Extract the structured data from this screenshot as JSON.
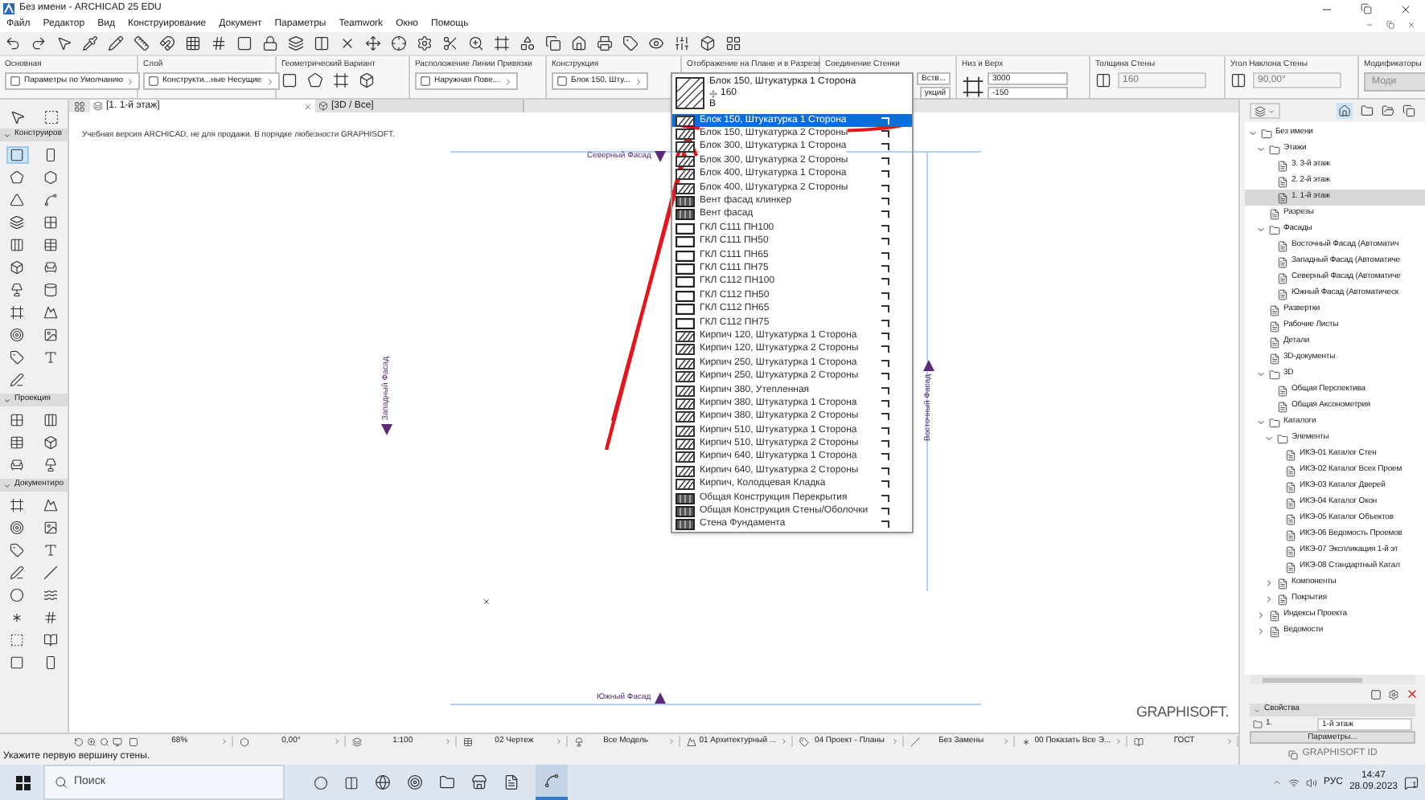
{
  "window": {
    "title": "Без имени - ARCHICAD 25 EDU"
  },
  "menu": [
    "Файл",
    "Редактор",
    "Вид",
    "Конструирование",
    "Документ",
    "Параметры",
    "Teamwork",
    "Окно",
    "Помощь"
  ],
  "info_box": {
    "groups": [
      {
        "label": "Основная",
        "kind": "dropdown",
        "value": "Параметры по Умолчанию"
      },
      {
        "label": "Слой",
        "kind": "dropdown",
        "value": "Конструкти...ные Несущие"
      },
      {
        "label": "Геометрический Вариант",
        "kind": "icons"
      },
      {
        "label": "Расположение Линии Привязки",
        "kind": "dropdown",
        "value": "Наружная Пове..."
      },
      {
        "label": "Конструкция",
        "kind": "dropdown",
        "value": "Блок 150, Шту..."
      },
      {
        "label": "Отображение на Плане и в Разрезе",
        "kind": "blank"
      },
      {
        "label": "Соединение Стенки",
        "kind": "pair",
        "values": [
          "Вств...",
          "укций"
        ]
      },
      {
        "label": "Низ и Верх",
        "kind": "fields",
        "values": [
          "3000",
          "-150"
        ]
      },
      {
        "label": "Толщина Стены",
        "kind": "field",
        "value": "160",
        "disabled": true
      },
      {
        "label": "Угол Наклона Стены",
        "kind": "field",
        "value": "90,00°",
        "disabled": true
      },
      {
        "label": "Модификаторы",
        "kind": "button",
        "value": "Моди"
      }
    ]
  },
  "toolbox": {
    "sections": [
      {
        "label": "Конструиров",
        "expanded": true,
        "tools": [
          {
            "selected": true
          },
          {
            "selected": false
          },
          {
            "selected": false
          },
          {
            "selected": false
          },
          {
            "selected": false
          },
          {
            "selected": false
          },
          {
            "selected": false
          },
          {
            "selected": false
          },
          {
            "selected": false
          },
          {
            "selected": false
          },
          {
            "selected": false
          },
          {
            "selected": false
          },
          {
            "selected": false
          },
          {
            "selected": false
          },
          {
            "selected": false
          },
          {
            "selected": false
          },
          {
            "selected": false
          },
          {
            "selected": false
          },
          {
            "selected": false
          },
          {
            "selected": false
          },
          {
            "selected": false
          }
        ]
      },
      {
        "label": "Проекция",
        "expanded": true,
        "tools": [
          {
            "selected": false
          },
          {
            "selected": false
          },
          {
            "selected": false
          },
          {
            "selected": false
          },
          {
            "selected": false
          },
          {
            "selected": false
          }
        ]
      },
      {
        "label": "Документиро",
        "expanded": true,
        "tools": [
          {
            "selected": false
          },
          {
            "selected": false
          },
          {
            "selected": false
          },
          {
            "selected": false
          },
          {
            "selected": false
          },
          {
            "selected": false
          },
          {
            "selected": false
          },
          {
            "selected": false
          },
          {
            "selected": false
          },
          {
            "selected": false
          },
          {
            "selected": false
          },
          {
            "selected": false
          },
          {
            "selected": false
          },
          {
            "selected": false
          },
          {
            "selected": false
          },
          {
            "selected": false
          }
        ]
      }
    ]
  },
  "tabs": [
    {
      "label": "[1. 1-й этаж]",
      "selected": true
    },
    {
      "label": "[3D / Все]",
      "selected": false
    }
  ],
  "canvas": {
    "notice": "Учебная версия ARCHICAD, не для продажи. В порядке любезности GRAPHISOFT.",
    "markers": [
      {
        "label": "Северный Фасад",
        "kind": "top"
      },
      {
        "label": "Западный Фасад",
        "kind": "left"
      },
      {
        "label": "Восточный Фасад",
        "kind": "right"
      },
      {
        "label": "Южный Фасад",
        "kind": "bottom"
      }
    ],
    "logo": "GRAPHISOFT."
  },
  "dropdown": {
    "preview": {
      "name": "Блок 150, Штукатурка 1 Сторона",
      "thickness": "160",
      "code": "В"
    },
    "items": [
      {
        "label": "Блок 150, Штукатурка 1 Сторона",
        "kind": "hatch",
        "selected": true
      },
      {
        "label": "Блок 150, Штукатурка 2 Стороны",
        "kind": "hatch",
        "selected": false
      },
      {
        "label": "Блок 300, Штукатурка 1 Сторона",
        "kind": "hatch",
        "selected": false
      },
      {
        "label": "Блок 300, Штукатурка 2 Стороны",
        "kind": "hatch",
        "selected": false
      },
      {
        "label": "Блок 400, Штукатурка 1 Сторона",
        "kind": "hatch",
        "selected": false
      },
      {
        "label": "Блок 400, Штукатурка 2 Стороны",
        "kind": "hatch",
        "selected": false
      },
      {
        "label": "Вент фасад клинкер",
        "kind": "dark",
        "selected": false
      },
      {
        "label": "Вент фасад",
        "kind": "dark",
        "selected": false
      },
      {
        "label": "ГКЛ С111 ПН100",
        "kind": "frame",
        "selected": false
      },
      {
        "label": "ГКЛ С111 ПН50",
        "kind": "frame",
        "selected": false
      },
      {
        "label": "ГКЛ С111 ПН65",
        "kind": "frame",
        "selected": false
      },
      {
        "label": "ГКЛ С111 ПН75",
        "kind": "frame",
        "selected": false
      },
      {
        "label": "ГКЛ С112 ПН100",
        "kind": "frame",
        "selected": false
      },
      {
        "label": "ГКЛ С112 ПН50",
        "kind": "frame",
        "selected": false
      },
      {
        "label": "ГКЛ С112 ПН65",
        "kind": "frame",
        "selected": false
      },
      {
        "label": "ГКЛ С112 ПН75",
        "kind": "frame",
        "selected": false
      },
      {
        "label": "Кирпич 120, Штукатурка 1 Сторона",
        "kind": "hatch",
        "selected": false
      },
      {
        "label": "Кирпич 120, Штукатурка 2 Стороны",
        "kind": "hatch",
        "selected": false
      },
      {
        "label": "Кирпич 250, Штукатурка 1 Сторона",
        "kind": "hatch",
        "selected": false
      },
      {
        "label": "Кирпич 250, Штукатурка 2 Стороны",
        "kind": "hatch",
        "selected": false
      },
      {
        "label": "Кирпич 380, Утепленная",
        "kind": "hatch",
        "selected": false
      },
      {
        "label": "Кирпич 380, Штукатурка 1 Сторона",
        "kind": "hatch",
        "selected": false
      },
      {
        "label": "Кирпич 380, Штукатурка 2 Стороны",
        "kind": "hatch",
        "selected": false
      },
      {
        "label": "Кирпич 510, Штукатурка 1 Сторона",
        "kind": "hatch",
        "selected": false
      },
      {
        "label": "Кирпич 510, Штукатурка 2 Стороны",
        "kind": "hatch",
        "selected": false
      },
      {
        "label": "Кирпич 640, Штукатурка 1 Сторона",
        "kind": "hatch",
        "selected": false
      },
      {
        "label": "Кирпич 640, Штукатурка 2 Стороны",
        "kind": "hatch",
        "selected": false
      },
      {
        "label": "Кирпич, Колодцевая Кладка",
        "kind": "hatch",
        "selected": false
      },
      {
        "label": "Общая Конструкция Перекрытия",
        "kind": "dark",
        "selected": false
      },
      {
        "label": "Общая Конструкция Стены/Оболочки",
        "kind": "dark",
        "selected": false
      },
      {
        "label": "Стена Фундамента",
        "kind": "dark",
        "selected": false
      }
    ]
  },
  "navigator": {
    "tree": [
      {
        "label": "Без имени",
        "expanded": true,
        "children": [
          {
            "label": "Этажи",
            "expanded": true,
            "children": [
              {
                "label": "3. 3-й этаж",
                "selected": false
              },
              {
                "label": "2. 2-й этаж",
                "selected": false
              },
              {
                "label": "1. 1-й этаж",
                "selected": true
              }
            ]
          },
          {
            "label": "Разрезы"
          },
          {
            "label": "Фасады",
            "expanded": true,
            "children": [
              {
                "label": "Восточный Фасад (Автоматич"
              },
              {
                "label": "Западный Фасад (Автоматиче"
              },
              {
                "label": "Северный Фасад (Автоматиче"
              },
              {
                "label": "Южный Фасад (Автоматическ"
              }
            ]
          },
          {
            "label": "Развертки"
          },
          {
            "label": "Рабочие Листы"
          },
          {
            "label": "Детали"
          },
          {
            "label": "3D-документы"
          },
          {
            "label": "3D",
            "expanded": true,
            "children": [
              {
                "label": "Общая Перспектива"
              },
              {
                "label": "Общая Аксонометрия"
              }
            ]
          },
          {
            "label": "Каталоги",
            "expanded": true,
            "children": [
              {
                "label": "Элементы",
                "expanded": true,
                "children": [
                  {
                    "label": "ИКЭ-01 Каталог Стен"
                  },
                  {
                    "label": "ИКЭ-02 Каталог Всех Проем"
                  },
                  {
                    "label": "ИКЭ-03 Каталог Дверей"
                  },
                  {
                    "label": "ИКЭ-04 Каталог Окон"
                  },
                  {
                    "label": "ИКЭ-05 Каталог Объектов"
                  },
                  {
                    "label": "ИКЭ-06 Ведомость Проемов"
                  },
                  {
                    "label": "ИКЭ-07 Экспликация 1-й эт"
                  },
                  {
                    "label": "ИКЭ-08 Стандартный Катал"
                  }
                ]
              },
              {
                "label": "Компоненты",
                "expanded": false
              },
              {
                "label": "Покрытия",
                "expanded": false
              }
            ]
          },
          {
            "label": "Индексы Проекта",
            "expanded": false
          },
          {
            "label": "Ведомости",
            "expanded": false
          }
        ]
      }
    ],
    "properties": {
      "title": "Свойства",
      "index": "1.",
      "name": "1-й этаж",
      "button": "Параметры..."
    },
    "account": "GRAPHISOFT ID"
  },
  "status_bar": {
    "items": [
      "68%",
      "0,00°",
      "1:100",
      "02 Чертеж",
      "Все Модель",
      "01 Архитектурный ...",
      "04 Проект - Планы",
      "Без Замены",
      "00 Показать Все Э...",
      "ГОСТ"
    ],
    "prompt": "Укажите первую вершину стены."
  },
  "taskbar": {
    "search": "Поиск",
    "lang": "РУС",
    "time": "14:47",
    "date": "28.09.2023",
    "notifications": "1"
  }
}
